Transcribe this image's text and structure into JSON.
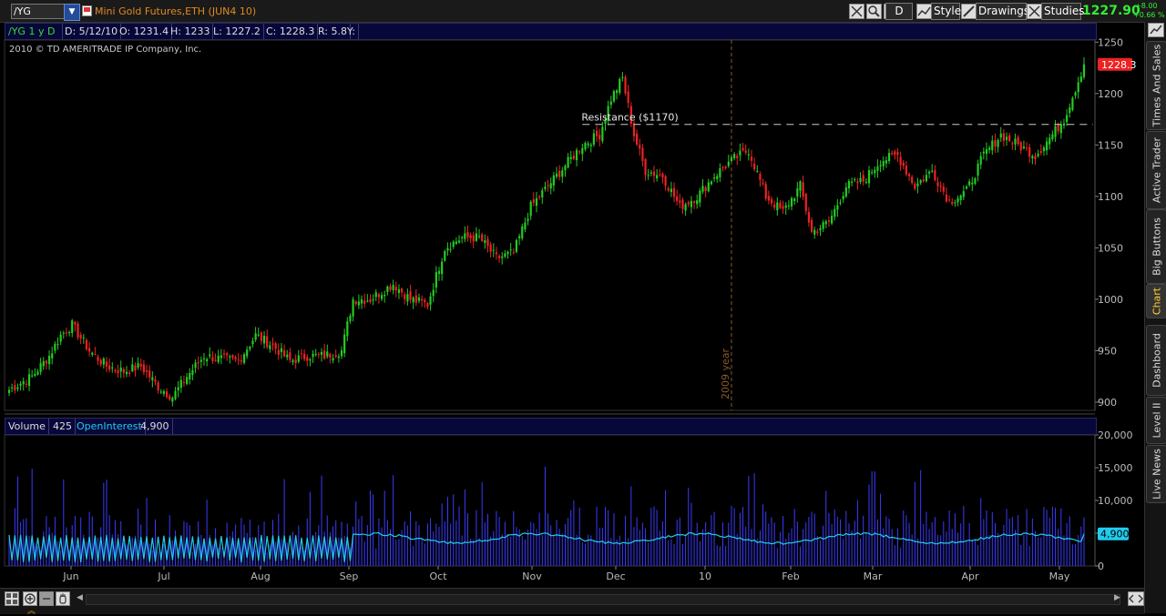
{
  "toolbar": {
    "symbol": "/YG",
    "symbol_dropdown": "▼",
    "description": "Mini Gold Futures,ETH (JUN4 10)",
    "period_button": "D",
    "style_label": "Style",
    "drawings_label": "Drawings",
    "studies_label": "Studies",
    "last_price": "1227.90",
    "change": "+8.00",
    "change_pct": "+0.66 %"
  },
  "info_row": {
    "symbol_period": "/YG 1 y D",
    "date": "D: 5/12/10",
    "open": "O: 1231.4",
    "high": "H: 1233",
    "low": "L: 1227.2",
    "close": "C: 1228.3",
    "range": "R: 5.8",
    "y": "Y:"
  },
  "copyright": "2010 © TD AMERITRADE IP Company, Inc.",
  "annotations": {
    "resistance_label": "Resistance ($1170)",
    "year_marker": "2009 year"
  },
  "volume_row": {
    "volume_label": "Volume",
    "volume_value": "425",
    "oi_label": "OpenInterest",
    "oi_value": "4,900"
  },
  "right_tabs": [
    {
      "label": "Times And Sales",
      "active": false
    },
    {
      "label": "Active Trader",
      "active": false
    },
    {
      "label": "Big Buttons",
      "active": false
    },
    {
      "label": "Chart",
      "active": true
    },
    {
      "label": "Dashboard",
      "active": false
    },
    {
      "label": "Level II",
      "active": false
    },
    {
      "label": "Live News",
      "active": false
    }
  ],
  "colors": {
    "up_candle": "#22cc22",
    "down_candle": "#ee2222",
    "volume_bar": "#3a3aff",
    "open_interest": "#22ccee",
    "last_price_tag": "#ee2222",
    "resistance_line": "#cccccc",
    "year_line": "#8a5a2a"
  },
  "chart_data": [
    {
      "type": "candlestick",
      "title": "",
      "price_axis": {
        "ticks": [
          "1250",
          "1200",
          "1150",
          "1100",
          "1050",
          "1000",
          "950",
          "900"
        ],
        "ylim": [
          892,
          1252
        ]
      },
      "x_tick_labels": [
        "Jun",
        "Jul",
        "Aug",
        "Sep",
        "Oct",
        "Nov",
        "Dec",
        "10",
        "Feb",
        "Mar",
        "Apr",
        "May"
      ],
      "last_price_tag": "1228.3",
      "resistance": 1170,
      "close_path": [
        {
          "i": 0,
          "c": 912
        },
        {
          "i": 8,
          "c": 925
        },
        {
          "i": 14,
          "c": 945
        },
        {
          "i": 18,
          "c": 965
        },
        {
          "i": 22,
          "c": 975
        },
        {
          "i": 28,
          "c": 950
        },
        {
          "i": 34,
          "c": 935
        },
        {
          "i": 40,
          "c": 930
        },
        {
          "i": 46,
          "c": 935
        },
        {
          "i": 52,
          "c": 915
        },
        {
          "i": 57,
          "c": 905
        },
        {
          "i": 62,
          "c": 925
        },
        {
          "i": 68,
          "c": 945
        },
        {
          "i": 74,
          "c": 942
        },
        {
          "i": 80,
          "c": 940
        },
        {
          "i": 86,
          "c": 965
        },
        {
          "i": 92,
          "c": 955
        },
        {
          "i": 98,
          "c": 940
        },
        {
          "i": 104,
          "c": 945
        },
        {
          "i": 110,
          "c": 945
        },
        {
          "i": 116,
          "c": 950
        },
        {
          "i": 120,
          "c": 1000
        },
        {
          "i": 126,
          "c": 1000
        },
        {
          "i": 134,
          "c": 1015
        },
        {
          "i": 140,
          "c": 1000
        },
        {
          "i": 146,
          "c": 995
        },
        {
          "i": 152,
          "c": 1050
        },
        {
          "i": 158,
          "c": 1060
        },
        {
          "i": 164,
          "c": 1060
        },
        {
          "i": 170,
          "c": 1040
        },
        {
          "i": 176,
          "c": 1045
        },
        {
          "i": 182,
          "c": 1090
        },
        {
          "i": 188,
          "c": 1110
        },
        {
          "i": 194,
          "c": 1130
        },
        {
          "i": 200,
          "c": 1150
        },
        {
          "i": 206,
          "c": 1160
        },
        {
          "i": 210,
          "c": 1195
        },
        {
          "i": 214,
          "c": 1215
        },
        {
          "i": 218,
          "c": 1160
        },
        {
          "i": 222,
          "c": 1125
        },
        {
          "i": 228,
          "c": 1120
        },
        {
          "i": 234,
          "c": 1090
        },
        {
          "i": 240,
          "c": 1100
        },
        {
          "i": 246,
          "c": 1120
        },
        {
          "i": 252,
          "c": 1135
        },
        {
          "i": 258,
          "c": 1145
        },
        {
          "i": 264,
          "c": 1100
        },
        {
          "i": 270,
          "c": 1085
        },
        {
          "i": 276,
          "c": 1110
        },
        {
          "i": 280,
          "c": 1065
        },
        {
          "i": 286,
          "c": 1075
        },
        {
          "i": 292,
          "c": 1110
        },
        {
          "i": 298,
          "c": 1115
        },
        {
          "i": 304,
          "c": 1135
        },
        {
          "i": 310,
          "c": 1140
        },
        {
          "i": 316,
          "c": 1110
        },
        {
          "i": 322,
          "c": 1125
        },
        {
          "i": 328,
          "c": 1095
        },
        {
          "i": 334,
          "c": 1105
        },
        {
          "i": 340,
          "c": 1140
        },
        {
          "i": 346,
          "c": 1160
        },
        {
          "i": 352,
          "c": 1150
        },
        {
          "i": 358,
          "c": 1140
        },
        {
          "i": 364,
          "c": 1160
        },
        {
          "i": 368,
          "c": 1175
        },
        {
          "i": 372,
          "c": 1205
        },
        {
          "i": 375,
          "c": 1228.3
        }
      ]
    },
    {
      "type": "bar+line",
      "series": [
        {
          "name": "Volume",
          "last": 425
        },
        {
          "name": "OpenInterest",
          "last": 4900
        }
      ],
      "value_axis": {
        "ticks": [
          "20,000",
          "15,000",
          "10,000",
          "5,000",
          "0"
        ],
        "ylim": [
          0,
          20000
        ]
      },
      "last_value_tag": "4,900"
    }
  ]
}
